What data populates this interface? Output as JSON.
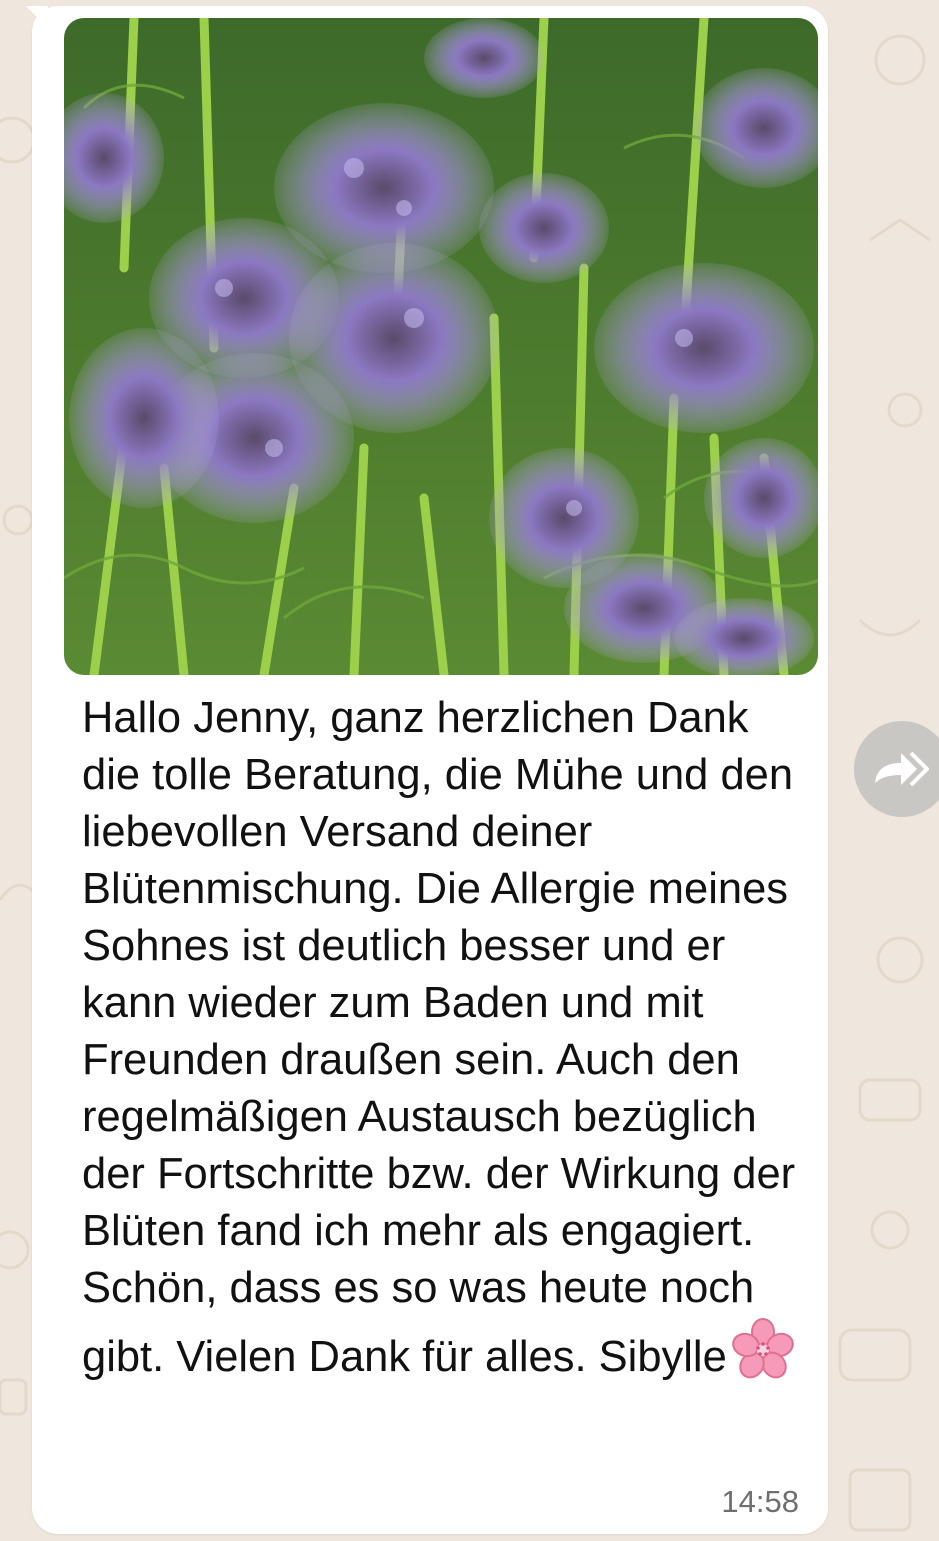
{
  "message": {
    "body": "Hallo Jenny, ganz herzlichen Dank die tolle Beratung, die Mühe und den liebevollen Versand deiner Blütenmischung. Die Allergie meines Sohnes ist deutlich besser und er kann wieder zum Baden und mit Freunden draußen sein. Auch den regelmäßigen Austausch bezüglich der Fortschritte bzw. der Wirkung der Blüten fand ich mehr als engagiert. Schön, dass es so was heute noch gibt. Vielen Dank für alles. Sibylle",
    "emoji": "cherry-blossom",
    "time": "14:58",
    "image": "phacelia-flowers-photo"
  },
  "actions": {
    "forward_icon": "forward-icon"
  },
  "colors": {
    "wallpaper": "#efe7de",
    "bubble": "#ffffff",
    "text": "#111111",
    "timestamp": "#6f6f6f",
    "forward_button": "#c9c7c3"
  }
}
